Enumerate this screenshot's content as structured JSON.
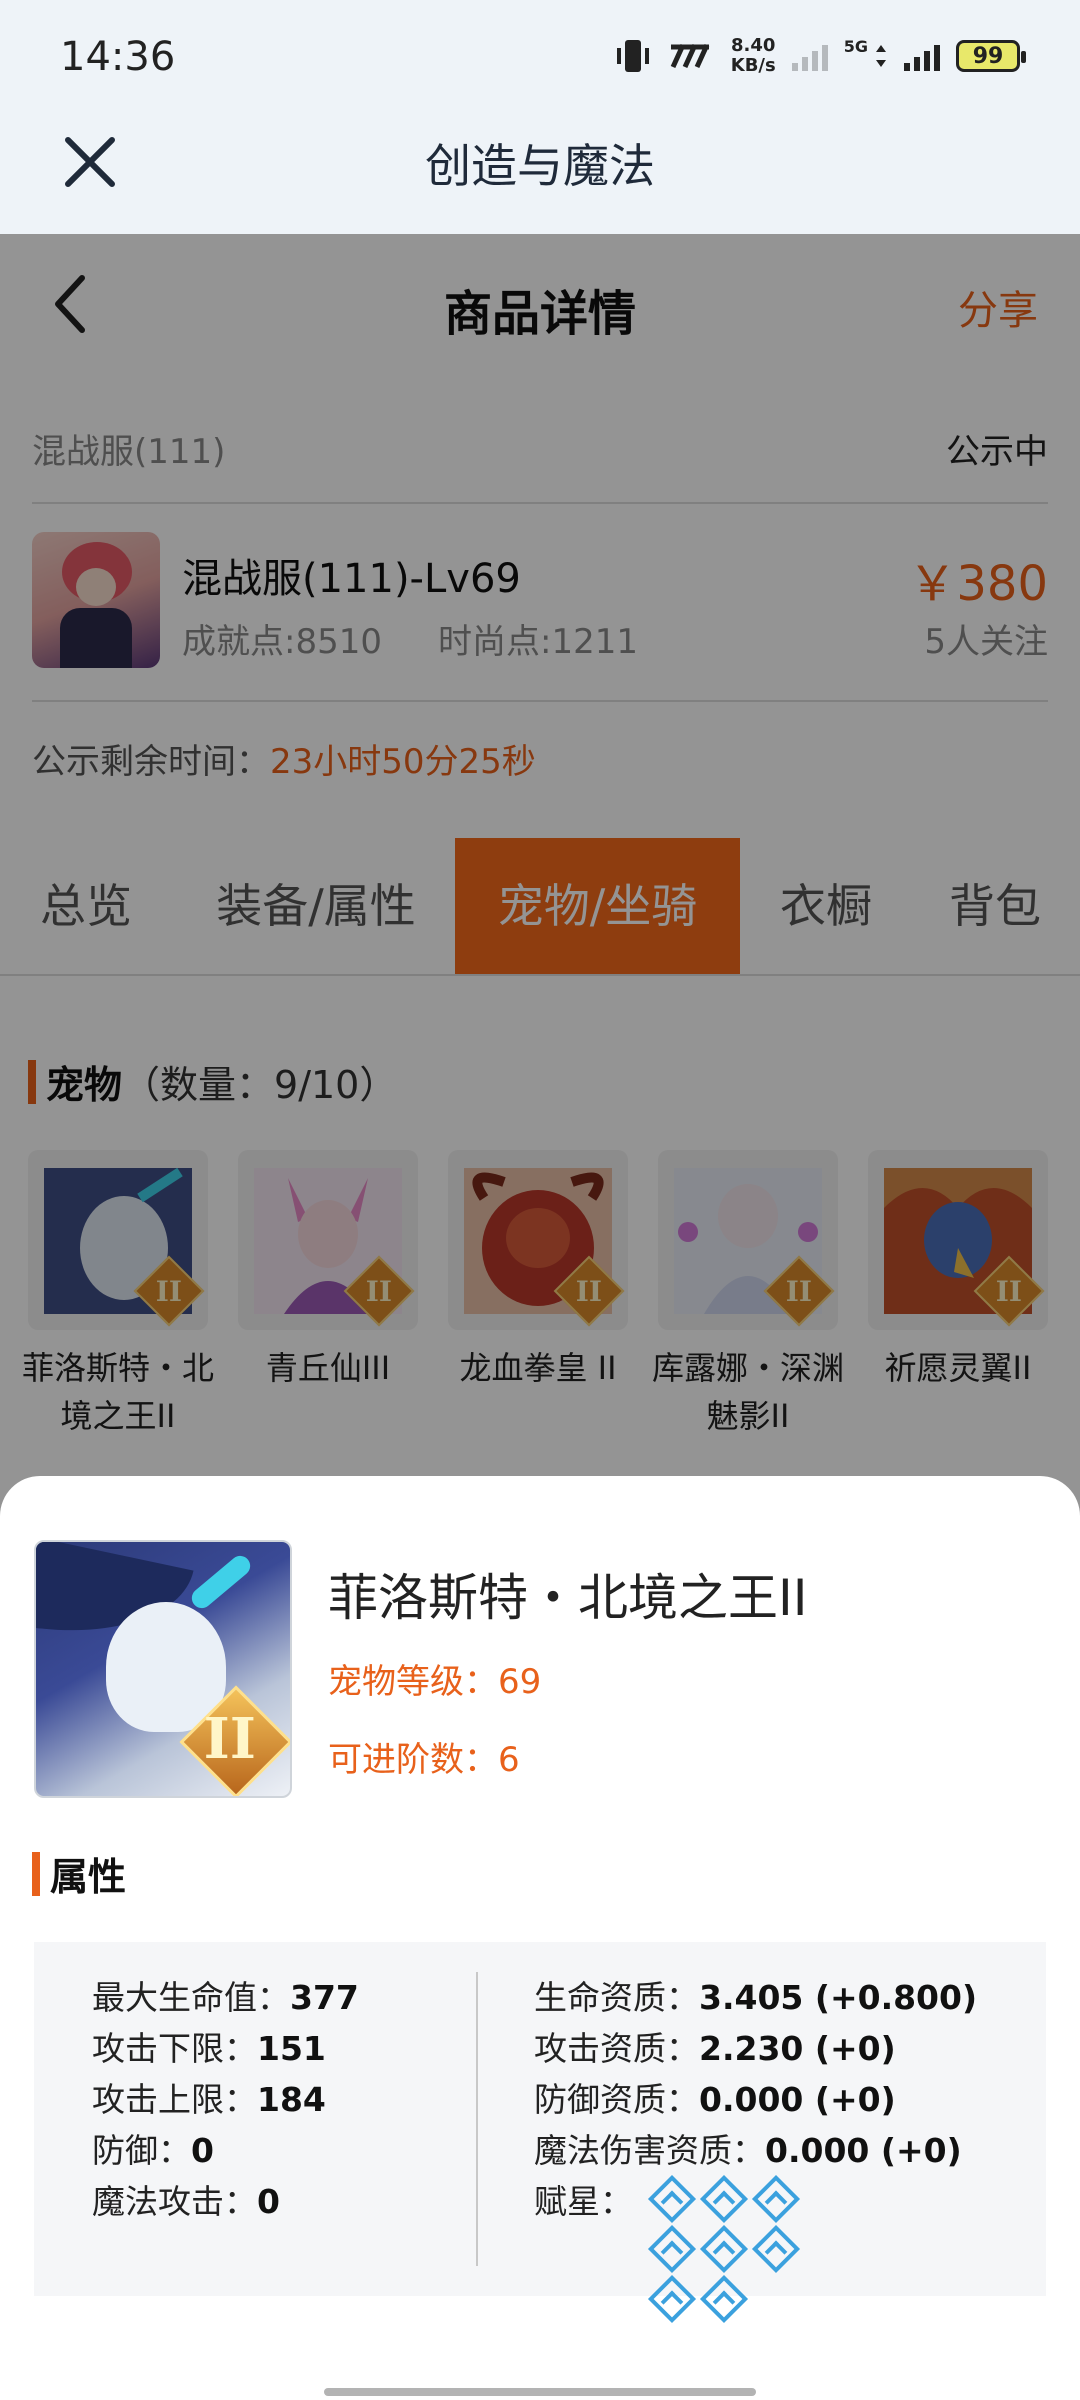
{
  "status": {
    "time": "14:36",
    "net_speed_value": "8.40",
    "net_speed_unit": "KB/s",
    "network_type": "5G",
    "battery": "99"
  },
  "header": {
    "title": "创造与魔法"
  },
  "page": {
    "title": "商品详情",
    "share_label": "分享"
  },
  "product": {
    "server": "混战服(111)",
    "status": "公示中",
    "name": "混战服(111)-Lv69",
    "achievement": "成就点:8510",
    "fashion": "时尚点:1211",
    "price": "￥380",
    "followers": "5人关注",
    "timer_label": "公示剩余时间：",
    "timer_value": "23小时50分25秒"
  },
  "tabs": [
    {
      "label": "总览"
    },
    {
      "label": "装备/属性"
    },
    {
      "label": "宠物/坐骑"
    },
    {
      "label": "衣橱"
    },
    {
      "label": "背包"
    }
  ],
  "pets": {
    "title": "宠物",
    "count_label": "（数量：9/10）",
    "items": [
      "菲洛斯特・北境之王II",
      "青丘仙III",
      "龙血拳皇 II",
      "库露娜・深渊魅影II",
      "祈愿灵翼II"
    ]
  },
  "detail": {
    "name": "菲洛斯特・北境之王II",
    "level": "宠物等级：69",
    "advance": "可进阶数：6",
    "attr_title": "属性",
    "left": [
      {
        "label": "最大生命值：",
        "value": "377"
      },
      {
        "label": "攻击下限：",
        "value": "151"
      },
      {
        "label": "攻击上限：",
        "value": "184"
      },
      {
        "label": "防御：",
        "value": "0"
      },
      {
        "label": "魔法攻击：",
        "value": "0"
      }
    ],
    "right": [
      {
        "label": "生命资质：",
        "value": "3.405 (+0.800)"
      },
      {
        "label": "攻击资质：",
        "value": "2.230 (+0)"
      },
      {
        "label": "防御资质：",
        "value": "0.000 (+0)"
      },
      {
        "label": "魔法伤害资质：",
        "value": "0.000 (+0)"
      }
    ],
    "star_label": "赋星：",
    "star_count": 8
  },
  "colors": {
    "accent": "#e8611b",
    "star": "#3ba1de",
    "header_bg": "#eef3f8"
  }
}
